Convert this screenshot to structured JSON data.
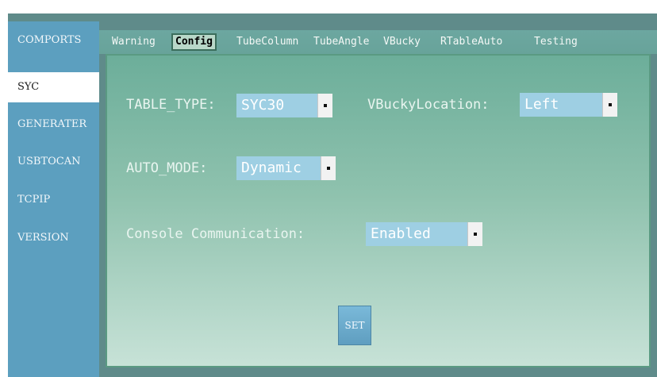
{
  "sidebar": {
    "items": [
      {
        "label": "COMPORTS"
      },
      {
        "label": "SYC"
      },
      {
        "label": "GENERATER"
      },
      {
        "label": "USBTOCAN"
      },
      {
        "label": "TCPIP"
      },
      {
        "label": "VERSION"
      }
    ],
    "active_index": 1
  },
  "tabs": [
    {
      "label": "Warning"
    },
    {
      "label": "Config"
    },
    {
      "label": "TubeColumn"
    },
    {
      "label": "TubeAngle"
    },
    {
      "label": "VBucky"
    },
    {
      "label": "RTableAuto"
    },
    {
      "label": "Testing"
    }
  ],
  "active_tab": "Config",
  "config": {
    "table_type": {
      "label": "TABLE_TYPE:",
      "value": "SYC30"
    },
    "vbucky_location": {
      "label": "VBuckyLocation:",
      "value": "Left"
    },
    "auto_mode": {
      "label": "AUTO_MODE:",
      "value": "Dynamic"
    },
    "console_communication": {
      "label": "Console Communication:",
      "value": "Enabled"
    }
  },
  "set_button": {
    "label": "SET"
  },
  "colors": {
    "sidebar": "#5c9fbf",
    "tabstrip": "#6ca7a0",
    "panel_top": "#6cae9a",
    "panel_bottom": "#c7e2d7",
    "combo": "#9ecfe3"
  }
}
